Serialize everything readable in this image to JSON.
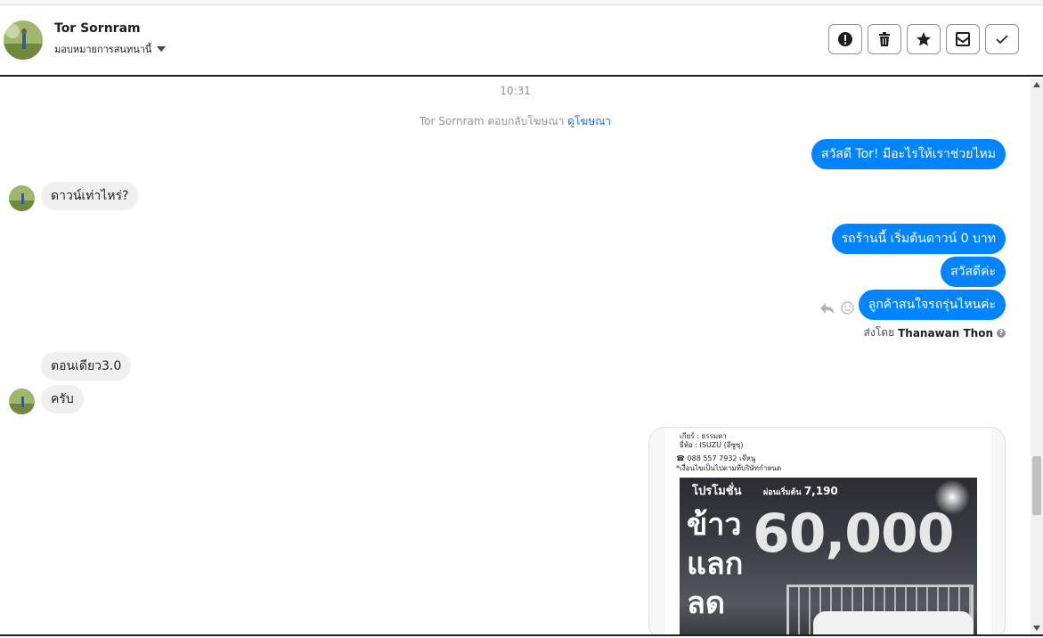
{
  "header": {
    "contact_name": "Tor Sornram",
    "assign_label": "มอบหมายการสนทนานี้",
    "actions": [
      {
        "icon": "alert-circle-icon",
        "label": "spam"
      },
      {
        "icon": "trash-icon",
        "label": "delete"
      },
      {
        "icon": "star-icon",
        "label": "star"
      },
      {
        "icon": "mark-unread-icon",
        "label": "unread"
      },
      {
        "icon": "checkmark-icon",
        "label": "done"
      }
    ]
  },
  "chat": {
    "timestamp": "10:31",
    "replied_text": "Tor Sornram ตอบกลับโฆษณา",
    "replied_link": "ดูโฆษณา",
    "messages": {
      "out_greeting": "สวัสดี Tor! มีอะไรให้เราช่วยไหม",
      "in_down": "ดาวน์เท่าไหร่?",
      "out_down_zero": "รถร้านนี้ เริ่มต้นดาวน์ 0 บาท",
      "out_hello": "สวัสดีค่ะ",
      "out_model": "ลูกค้าสนใจรถรุ่นไหนค่ะ",
      "in_now": "ตอนเดียว3.0",
      "in_krub": "ครับ"
    },
    "sent_by_prefix": "ส่งโดย",
    "sent_by_name": "Thanawan Thon",
    "help_glyph": "?"
  },
  "ad": {
    "gear_line": "เกียร์ : ธรรมดา",
    "brand_line": "ยี่ห้อ : ISUZU (อีซูซุ)",
    "phone_line": "☎ 088 557 7932 เจ๊หนู",
    "condition_line": "*เงื่อนไขเป็นไปตามที่บริษัทกำหนด",
    "promo": "โปรโมชั่น",
    "down_prefix": "ผ่อนเริ่มต้น",
    "down_amount": "7,190",
    "big_line1": "ข้าว",
    "big_line2": "แลก",
    "big_line3": "ลด",
    "big_number": "60,000"
  },
  "colors": {
    "outgoing_bubble": "#0084ff",
    "incoming_bubble": "#f0f0f0",
    "link": "#216fdb"
  }
}
